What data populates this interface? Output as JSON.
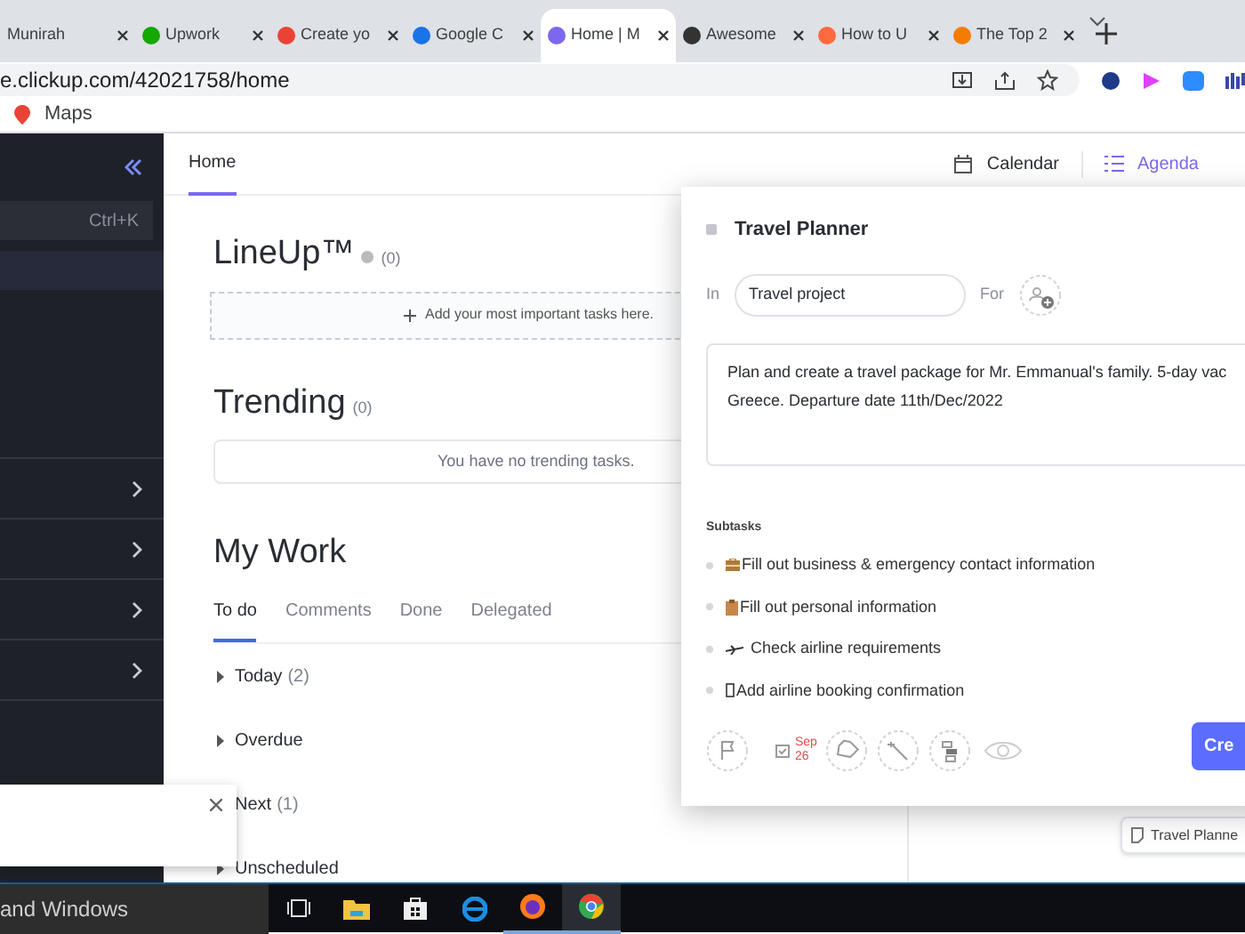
{
  "browser": {
    "tabs": [
      {
        "title": "Munirah",
        "selected": false
      },
      {
        "title": "Upwork",
        "selected": false
      },
      {
        "title": "Create yo",
        "selected": false
      },
      {
        "title": "Google C",
        "selected": false
      },
      {
        "title": "Home | M",
        "selected": true
      },
      {
        "title": "Awesome",
        "selected": false
      },
      {
        "title": "How to U",
        "selected": false
      },
      {
        "title": "The Top 2",
        "selected": false
      }
    ],
    "address": "e.clickup.com/42021758/home",
    "bookmarks": [
      "Maps"
    ]
  },
  "sidebar": {
    "search_shortcut": "Ctrl+K"
  },
  "header": {
    "tab": "Home",
    "views": [
      {
        "label": "Calendar",
        "selected": false
      },
      {
        "label": "Agenda",
        "selected": true
      }
    ]
  },
  "lineup": {
    "title": "LineUp™",
    "count": "(0)",
    "placeholder": "Add your most important tasks here."
  },
  "trending": {
    "title": "Trending",
    "count": "(0)",
    "empty": "You have no trending tasks."
  },
  "my_work": {
    "title": "My Work",
    "tabs": [
      {
        "label": "To do",
        "selected": true
      },
      {
        "label": "Comments",
        "selected": false
      },
      {
        "label": "Done",
        "selected": false
      },
      {
        "label": "Delegated",
        "selected": false
      }
    ],
    "groups": [
      {
        "label": "Today",
        "count": "(2)"
      },
      {
        "label": "Overdue"
      },
      {
        "label": "Next",
        "count": "(1)"
      },
      {
        "label": "Unscheduled"
      }
    ]
  },
  "task_modal": {
    "title": "Travel Planner",
    "in_label": "In",
    "list": "Travel project",
    "for_label": "For",
    "description": "Plan and create a travel package for Mr. Emmanual's family. 5-day vac\nGreece. Departure date 11th/Dec/2022",
    "subtasks_label": "Subtasks",
    "subtasks": [
      "Fill out business & emergency contact information",
      "Fill out personal information",
      "Check airline requirements",
      "Add airline booking confirmation"
    ],
    "due_month": "Sep",
    "due_day": "26",
    "create_button": "Cre"
  },
  "chip": "Travel Planne",
  "taskbar": {
    "search": "and Windows"
  }
}
